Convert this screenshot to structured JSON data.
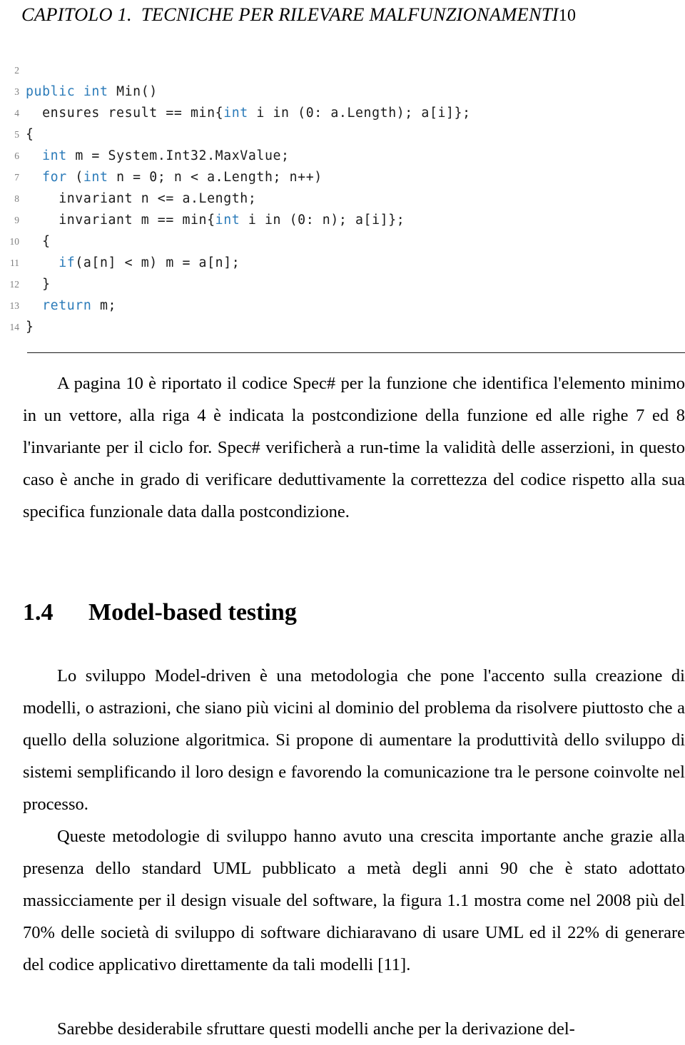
{
  "header": {
    "chapter_label": "CAPITOLO 1.",
    "chapter_title": "TECNICHE PER RILEVARE MALFUNZIONAMENTI",
    "page_number": "10"
  },
  "listing": {
    "syntax_keyword_color": "#2b7bb9",
    "line_number_color": "#808080",
    "lines": [
      {
        "number": "2",
        "code": ""
      },
      {
        "number": "3",
        "code": "public int Min()"
      },
      {
        "number": "4",
        "code": "  ensures result == min{int i in (0: a.Length); a[i]};"
      },
      {
        "number": "5",
        "code": "{"
      },
      {
        "number": "6",
        "code": "  int m = System.Int32.MaxValue;"
      },
      {
        "number": "7",
        "code": "  for (int n = 0; n < a.Length; n++)"
      },
      {
        "number": "8",
        "code": "    invariant n <= a.Length;"
      },
      {
        "number": "9",
        "code": "    invariant m == min{int i in (0: n); a[i]};"
      },
      {
        "number": "10",
        "code": "  {"
      },
      {
        "number": "11",
        "code": "    if(a[n] < m) m = a[n];"
      },
      {
        "number": "12",
        "code": "  }"
      },
      {
        "number": "13",
        "code": "  return m;"
      },
      {
        "number": "14",
        "code": "}"
      }
    ],
    "keywords": [
      "public",
      "int",
      "for",
      "if",
      "return"
    ]
  },
  "body": {
    "paragraph_spec": "A pagina 10 è riportato il codice Spec# per la funzione che identifica l'elemento minimo in un vettore, alla riga 4 è indicata la postcondizione della funzione ed alle righe 7 ed 8 l'invariante per il ciclo for. Spec# verificherà a run-time la validità delle asserzioni, in questo caso è anche in grado di verificare deduttivamente la correttezza del codice rispetto alla sua specifica funzionale data dalla postcondizione.",
    "section": {
      "number": "1.4",
      "title": "Model-based testing"
    },
    "paragraph_model_driven": "Lo sviluppo Model-driven è una metodologia che pone l'accento sulla creazione di modelli, o astrazioni, che siano più vicini al dominio del problema da risolvere piuttosto che a quello della soluzione algoritmica. Si propone di aumentare la produttività dello sviluppo di sistemi semplificando il loro design e favorendo la comunicazione tra le persone coinvolte nel processo.",
    "paragraph_uml_growth": "Queste metodologie di sviluppo hanno avuto una crescita importante anche grazie alla presenza dello standard UML pubblicato a metà degli anni 90 che è stato adottato massicciamente per il design visuale del software, la figura 1.1 mostra come nel 2008 più del 70% delle società di sviluppo di software dichiaravano di usare UML ed il 22% di generare del codice applicativo direttamente da tali modelli [11].",
    "paragraph_last_partial": "Sarebbe desiderabile sfruttare questi modelli anche per la derivazione del-"
  }
}
